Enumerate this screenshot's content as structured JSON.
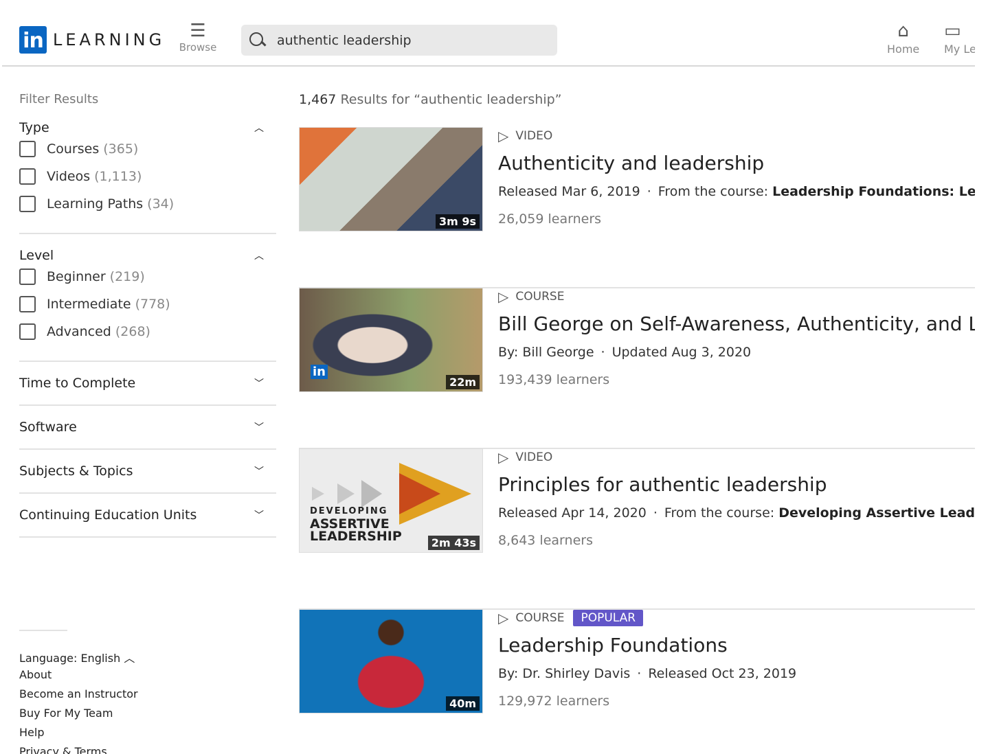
{
  "header": {
    "logo_text": "LEARNING",
    "browse": "Browse",
    "search_value": "authentic leadership",
    "home": "Home",
    "my_learning": "My Learning"
  },
  "filters": {
    "title": "Filter Results",
    "type": {
      "label": "Type",
      "options": [
        {
          "label": "Courses",
          "count": "(365)"
        },
        {
          "label": "Videos",
          "count": "(1,113)"
        },
        {
          "label": "Learning Paths",
          "count": "(34)"
        }
      ]
    },
    "level": {
      "label": "Level",
      "options": [
        {
          "label": "Beginner",
          "count": "(219)"
        },
        {
          "label": "Intermediate",
          "count": "(778)"
        },
        {
          "label": "Advanced",
          "count": "(268)"
        }
      ]
    },
    "collapsed": [
      "Time to Complete",
      "Software",
      "Subjects & Topics",
      "Continuing Education Units"
    ]
  },
  "footer": {
    "language": "Language: English",
    "links": [
      "About",
      "Become an Instructor",
      "Buy For My Team",
      "Help",
      "Privacy & Terms"
    ]
  },
  "results_count": "1,467",
  "results_label": "Results for “authentic leadership”",
  "results": [
    {
      "kind": "VIDEO",
      "title": "Authenticity and leadership",
      "meta1": "Released Mar 6, 2019",
      "meta2_prefix": "From the course:",
      "meta2_bold": "Leadership Foundations: Leadership Styles",
      "learners": "26,059 learners",
      "duration": "3m 9s"
    },
    {
      "kind": "COURSE",
      "title": "Bill George on Self-Awareness, Authenticity, and Leadership",
      "meta1": "By: Bill George",
      "meta2_prefix": "Updated Aug 3, 2020",
      "meta2_bold": "",
      "learners": "193,439 learners",
      "duration": "22m"
    },
    {
      "kind": "VIDEO",
      "title": "Principles for authentic leadership",
      "meta1": "Released Apr 14, 2020",
      "meta2_prefix": "From the course:",
      "meta2_bold": "Developing Assertive Leadership",
      "learners": "8,643 learners",
      "duration": "2m 43s",
      "thumb_text": [
        "DEVELOPING",
        "ASSERTIVE",
        "LEADERSHIP"
      ]
    },
    {
      "kind": "COURSE",
      "badge": "POPULAR",
      "title": "Leadership Foundations",
      "meta1": "By: Dr. Shirley Davis",
      "meta2_prefix": "Released Oct 23, 2019",
      "meta2_bold": "",
      "learners": "129,972 learners",
      "duration": "40m"
    }
  ],
  "colors": {
    "brand": "#0a66c2",
    "badge": "#6256c8"
  }
}
